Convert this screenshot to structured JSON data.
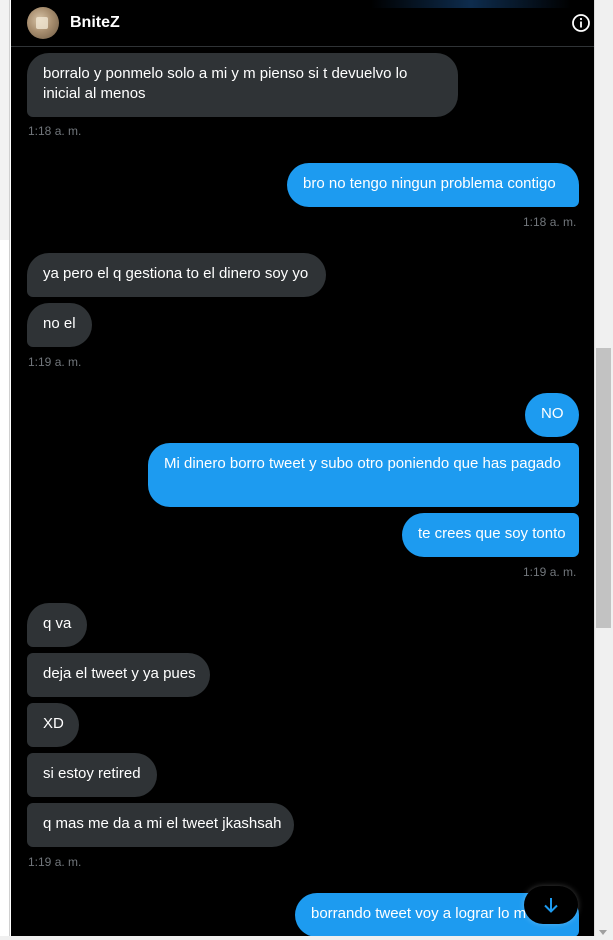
{
  "header": {
    "contact_name": "BniteZ",
    "avatar_icon": "user-avatar",
    "info_icon": "info-circle-icon"
  },
  "colors": {
    "background": "#000000",
    "incoming_bubble": "#2f3336",
    "outgoing_bubble": "#1d9bf0",
    "timestamp": "#71767b"
  },
  "messages": [
    {
      "side": "in",
      "text": "borralo y ponmelo solo a mi y m pienso si t devuelvo lo inicial al menos"
    },
    {
      "side": "out",
      "text": "bro no tengo ningun problema contigo"
    },
    {
      "side": "in",
      "text": "ya pero el q gestiona to el dinero soy yo"
    },
    {
      "side": "in",
      "text": "no el"
    },
    {
      "side": "out",
      "text": "NO"
    },
    {
      "side": "out",
      "text": "Mi dinero borro tweet y subo otro poniendo que has pagado"
    },
    {
      "side": "out",
      "text": "te crees que soy tonto"
    },
    {
      "side": "in",
      "text": "q va"
    },
    {
      "side": "in",
      "text": "deja el tweet y ya pues"
    },
    {
      "side": "in",
      "text": "XD"
    },
    {
      "side": "in",
      "text": "si estoy retired"
    },
    {
      "side": "in",
      "text": "q mas me da a mi el tweet jkashsah"
    },
    {
      "side": "out",
      "text": "borrando tweet voy a lograr lo m"
    }
  ],
  "timestamps": [
    "1:18 a. m.",
    "1:18 a. m.",
    "1:19 a. m.",
    "1:19 a. m.",
    "1:19 a. m."
  ],
  "scroll_to_bottom_icon": "arrow-down-icon"
}
